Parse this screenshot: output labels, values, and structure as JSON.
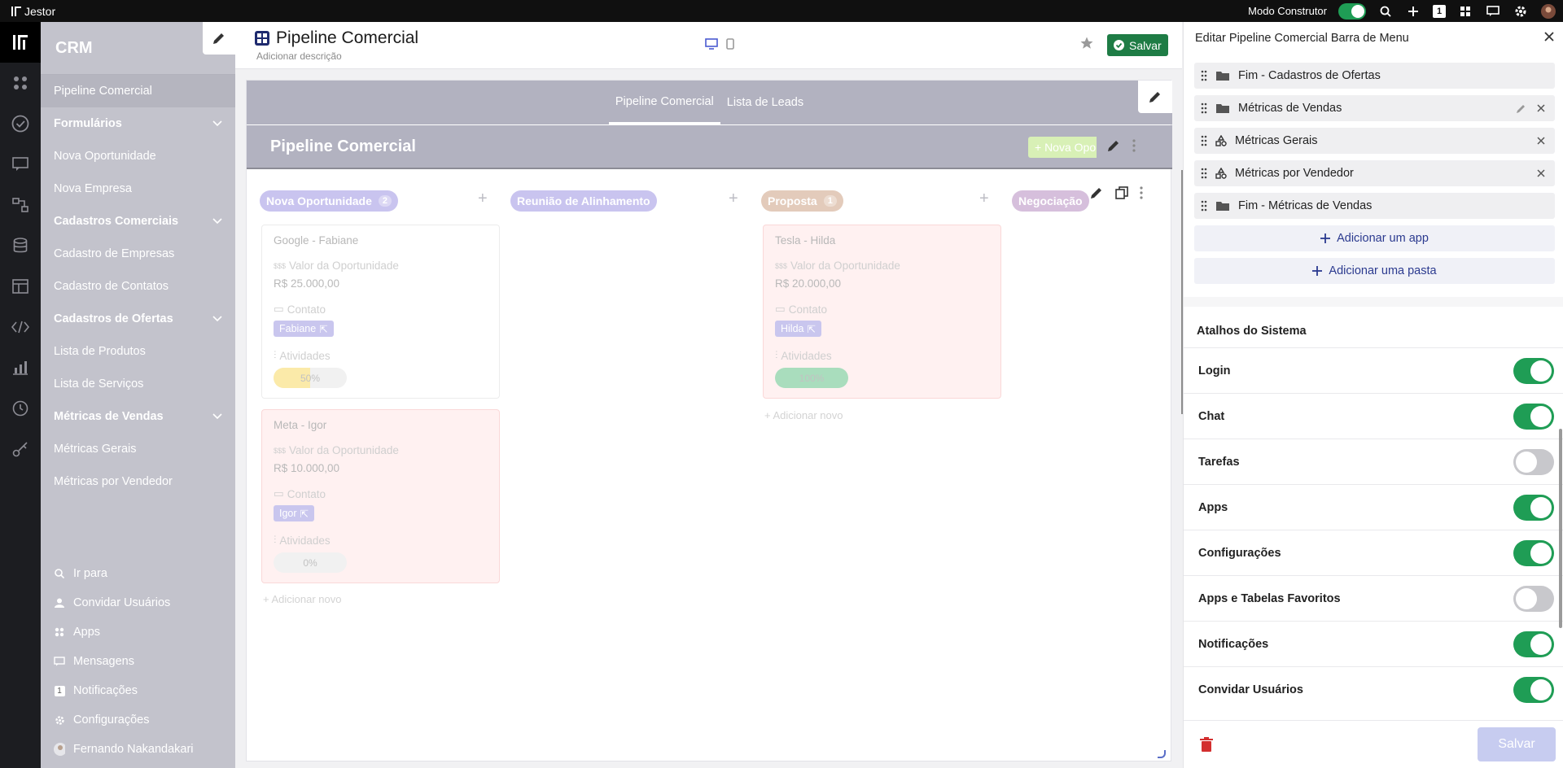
{
  "topbar": {
    "brand": "Jestor",
    "mode_label": "Modo Construtor",
    "notif_count": "1"
  },
  "sidebar": {
    "title": "CRM",
    "items": [
      {
        "label": "Pipeline Comercial",
        "type": "item",
        "active": true
      },
      {
        "label": "Formulários",
        "type": "group"
      },
      {
        "label": "Nova Oportunidade",
        "type": "item"
      },
      {
        "label": "Nova Empresa",
        "type": "item"
      },
      {
        "label": "Cadastros Comerciais",
        "type": "group"
      },
      {
        "label": "Cadastro de Empresas",
        "type": "item"
      },
      {
        "label": "Cadastro de Contatos",
        "type": "item"
      },
      {
        "label": "Cadastros de Ofertas",
        "type": "group"
      },
      {
        "label": "Lista de Produtos",
        "type": "item"
      },
      {
        "label": "Lista de Serviços",
        "type": "item"
      },
      {
        "label": "Métricas de Vendas",
        "type": "group"
      },
      {
        "label": "Métricas Gerais",
        "type": "item"
      },
      {
        "label": "Métricas por Vendedor",
        "type": "item"
      }
    ],
    "bottom": [
      {
        "label": "Ir para",
        "icon": "search-icon"
      },
      {
        "label": "Convidar Usuários",
        "icon": "user-icon"
      },
      {
        "label": "Apps",
        "icon": "apps-icon"
      },
      {
        "label": "Mensagens",
        "icon": "chat-icon"
      },
      {
        "label": "Notificações",
        "icon": "notification-badge",
        "badge": "1"
      },
      {
        "label": "Configurações",
        "icon": "gear-icon"
      },
      {
        "label": "Fernando Nakandakari",
        "icon": "avatar"
      }
    ]
  },
  "page": {
    "title": "Pipeline Comercial",
    "description_placeholder": "Adicionar descrição",
    "save_label": "Salvar"
  },
  "canvas": {
    "tabs": [
      {
        "label": "Pipeline Comercial",
        "active": true
      },
      {
        "label": "Lista de Leads",
        "active": false
      }
    ],
    "section_title": "Pipeline Comercial",
    "new_button": "+ Nova Oportunidade",
    "add_new_label": "Adicionar novo",
    "columns": [
      {
        "name": "Nova Oportunidade",
        "count": "2",
        "color": "#c9c4ef"
      },
      {
        "name": "Reunião de Alinhamento",
        "count": "",
        "color": "#c9c4ef"
      },
      {
        "name": "Proposta",
        "count": "1",
        "color": "#e3cbbb"
      },
      {
        "name": "Negociação",
        "count": "",
        "color": "#d6bfdc"
      }
    ],
    "cards": [
      {
        "title": "Google - Fabiane",
        "value_label": "Valor da Oportunidade",
        "value": "R$ 25.000,00",
        "contact_label": "Contato",
        "contact": "Fabiane",
        "activities_label": "Atividades",
        "progress": "50%",
        "progress_value": 0.5,
        "bar_color": "#fbeaa9"
      },
      {
        "title": "Meta - Igor",
        "value_label": "Valor da Oportunidade",
        "value": "R$ 10.000,00",
        "contact_label": "Contato",
        "contact": "Igor",
        "activities_label": "Atividades",
        "progress": "0%",
        "progress_value": 0.0,
        "bar_color": "#f1f1f1"
      },
      {
        "title": "Tesla - Hilda",
        "value_label": "Valor da Oportunidade",
        "value": "R$ 20.000,00",
        "contact_label": "Contato",
        "contact": "Hilda",
        "activities_label": "Atividades",
        "progress": "100%",
        "progress_value": 1.0,
        "bar_color": "#a9ddbd"
      }
    ]
  },
  "panel": {
    "title": "Editar Pipeline Comercial Barra de Menu",
    "items": [
      {
        "label": "Fim - Cadastros de Ofertas",
        "icon": "folder-icon"
      },
      {
        "label": "Métricas de Vendas",
        "icon": "folder-icon"
      },
      {
        "label": "Métricas Gerais",
        "icon": "shapes-icon"
      },
      {
        "label": "Métricas por Vendedor",
        "icon": "shapes-icon"
      },
      {
        "label": "Fim - Métricas de Vendas",
        "icon": "folder-icon"
      }
    ],
    "add_app": "Adicionar um app",
    "add_folder": "Adicionar uma pasta",
    "section_title": "Atalhos do Sistema",
    "shortcuts": [
      {
        "label": "Login",
        "on": true
      },
      {
        "label": "Chat",
        "on": true
      },
      {
        "label": "Tarefas",
        "on": false
      },
      {
        "label": "Apps",
        "on": true
      },
      {
        "label": "Configurações",
        "on": true
      },
      {
        "label": "Apps e Tabelas Favoritos",
        "on": false
      },
      {
        "label": "Notificações",
        "on": true
      },
      {
        "label": "Convidar Usuários",
        "on": true
      }
    ],
    "save_label": "Salvar"
  },
  "colors": {
    "accent_green": "#1f9d55",
    "navy": "#1e2a6e",
    "link_blue": "#2b3a8f",
    "sidebar_bg": "#c3c3cc",
    "delete_red": "#d32f2f"
  }
}
